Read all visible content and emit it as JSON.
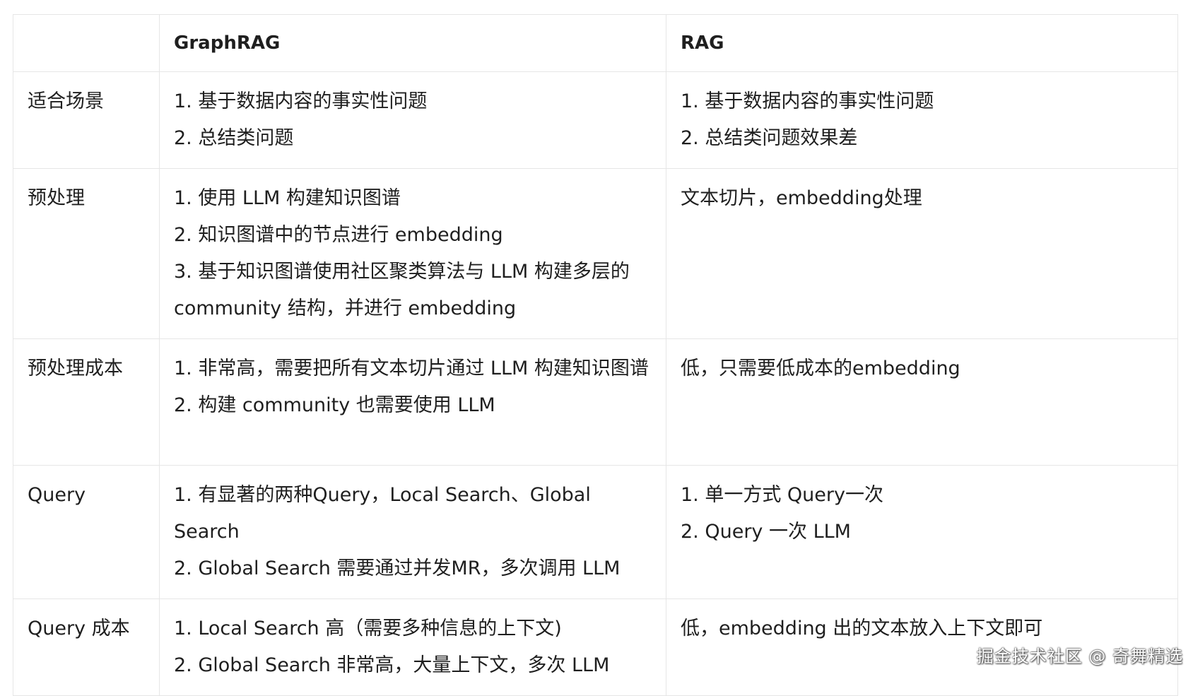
{
  "table": {
    "headers": [
      "",
      "GraphRAG",
      "RAG"
    ],
    "rows": [
      {
        "label": "适合场景",
        "graphrag": [
          "1. 基于数据内容的事实性问题",
          "2. 总结类问题"
        ],
        "rag": [
          "1. 基于数据内容的事实性问题",
          "2. 总结类问题效果差"
        ]
      },
      {
        "label": "预处理",
        "graphrag": [
          "1. 使用 LLM 构建知识图谱",
          "2. 知识图谱中的节点进行 embedding",
          "3. 基于知识图谱使用社区聚类算法与 LLM 构建多层的 community 结构，并进行 embedding"
        ],
        "rag": [
          "文本切片，embedding处理"
        ]
      },
      {
        "label": "预处理成本",
        "graphrag": [
          "1. 非常高，需要把所有文本切片通过 LLM 构建知识图谱",
          "2. 构建 community 也需要使用 LLM"
        ],
        "rag": [
          "低，只需要低成本的embedding"
        ]
      },
      {
        "label": "Query",
        "graphrag": [
          "1. 有显著的两种Query，Local Search、Global Search",
          "2. Global Search 需要通过并发MR，多次调用 LLM"
        ],
        "rag": [
          "1. 单一方式 Query一次",
          "2. Query 一次 LLM"
        ]
      },
      {
        "label": "Query 成本",
        "graphrag": [
          "1. Local Search 高（需要多种信息的上下文)",
          "2. Global Search 非常高，大量上下文，多次 LLM"
        ],
        "rag": [
          "低，embedding 出的文本放入上下文即可"
        ]
      }
    ]
  },
  "watermark": "掘金技术社区 @ 奇舞精选"
}
